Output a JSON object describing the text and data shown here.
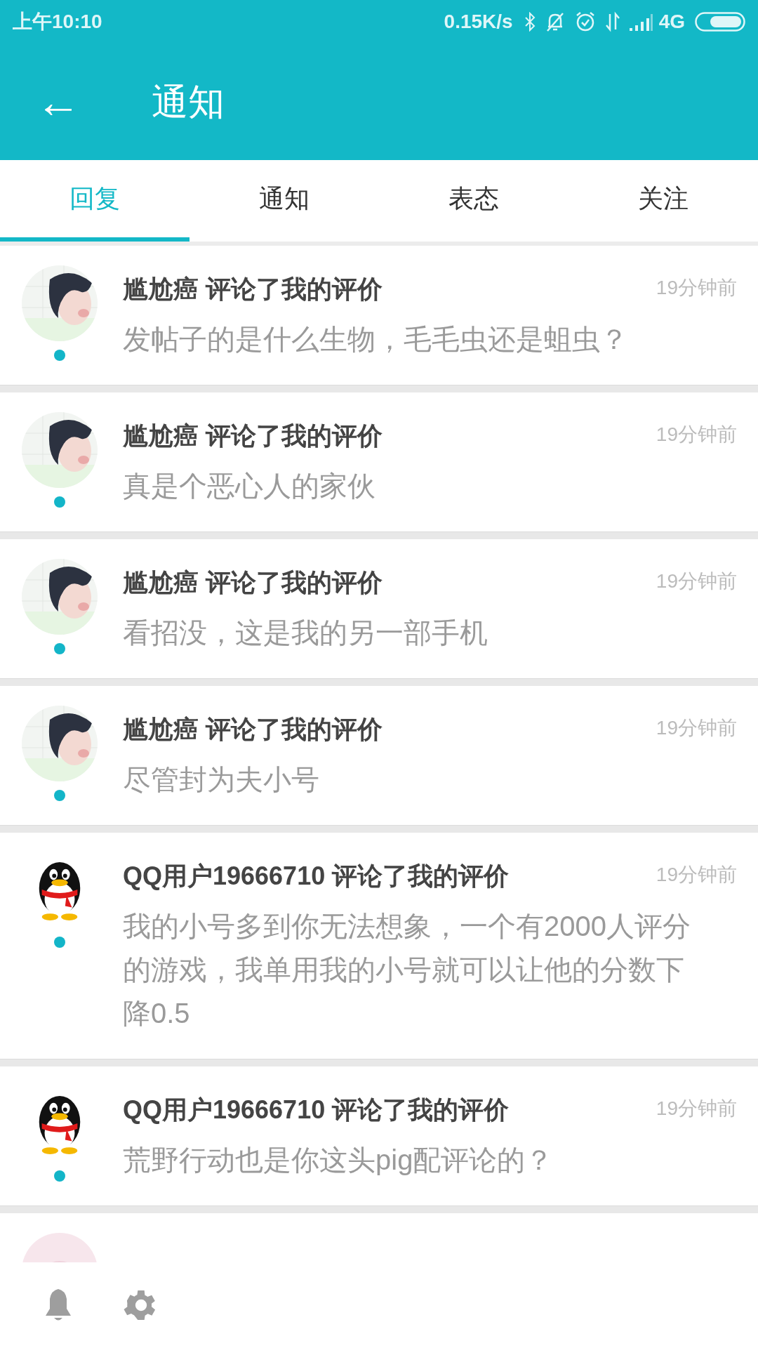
{
  "status_bar": {
    "time": "上午10:10",
    "speed": "0.15K/s",
    "network": "4G"
  },
  "header": {
    "back": "←",
    "title": "通知"
  },
  "tabs": [
    {
      "label": "回复",
      "selected": true
    },
    {
      "label": "通知",
      "selected": false
    },
    {
      "label": "表态",
      "selected": false
    },
    {
      "label": "关注",
      "selected": false
    }
  ],
  "items": [
    {
      "title": "尴尬癌 评论了我的评价",
      "time": "19分钟前",
      "message": "发帖子的是什么生物，毛毛虫还是蛆虫？",
      "unread": true
    },
    {
      "title": "尴尬癌 评论了我的评价",
      "time": "19分钟前",
      "message": "真是个恶心人的家伙",
      "unread": true
    },
    {
      "title": "尴尬癌 评论了我的评价",
      "time": "19分钟前",
      "message": "看招没，这是我的另一部手机",
      "unread": true
    },
    {
      "title": "尴尬癌 评论了我的评价",
      "time": "19分钟前",
      "message": "尽管封为夫小号",
      "unread": true
    },
    {
      "kind": "penguin",
      "title": "QQ用户19666710 评论了我的评价",
      "time": "19分钟前",
      "message": "我的小号多到你无法想象，一个有2000人评分的游戏，我单用我的小号就可以让他的分数下降0.5",
      "unread": true
    },
    {
      "kind": "penguin",
      "title": "QQ用户19666710 评论了我的评价",
      "time": "19分钟前",
      "message": "荒野行动也是你这头pig配评论的？",
      "unread": true
    },
    {
      "kind": "photo_pink"
    }
  ]
}
